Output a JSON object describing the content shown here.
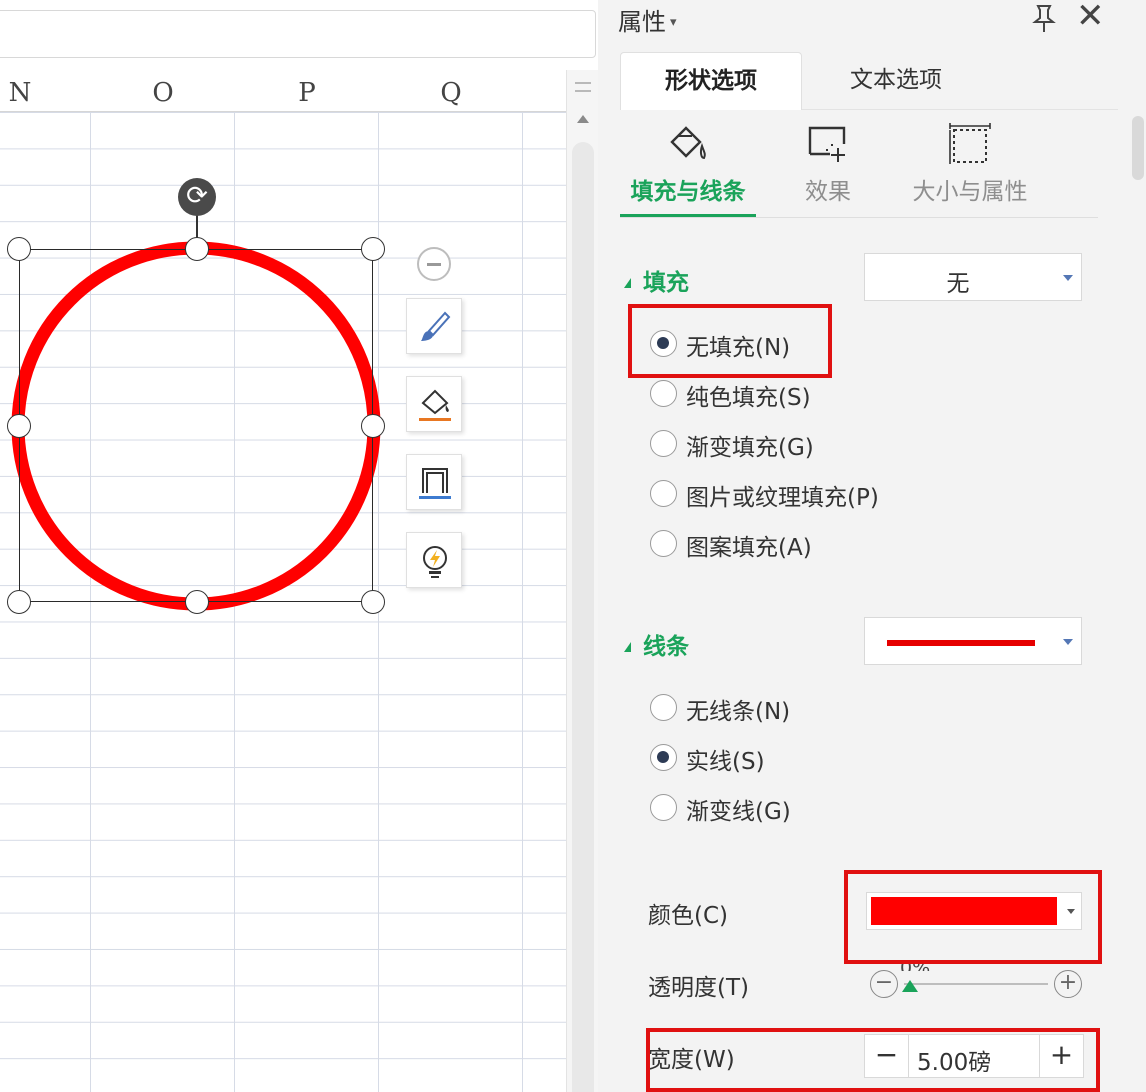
{
  "sheet": {
    "columns": [
      "N",
      "O",
      "P",
      "Q"
    ],
    "rotate_glyph": "⟳",
    "float_tools": [
      "collapse-icon",
      "brush-icon",
      "fill-bucket-icon",
      "outline-icon",
      "bulb-icon"
    ]
  },
  "panel": {
    "title": "属性",
    "title_caret": "▾",
    "close_glyph": "✕",
    "tabs": [
      {
        "label": "形状选项",
        "active": true
      },
      {
        "label": "文本选项",
        "active": false
      }
    ],
    "subtabs": [
      {
        "label": "填充与线条",
        "icon": "fill-line-icon",
        "active": true
      },
      {
        "label": "效果",
        "icon": "effects-icon",
        "active": false
      },
      {
        "label": "大小与属性",
        "icon": "size-properties-icon",
        "active": false
      }
    ],
    "fill": {
      "heading": "填充",
      "dropdown_value": "无",
      "options": [
        {
          "label": "无填充(N)",
          "checked": true
        },
        {
          "label": "纯色填充(S)",
          "checked": false
        },
        {
          "label": "渐变填充(G)",
          "checked": false
        },
        {
          "label": "图片或纹理填充(P)",
          "checked": false
        },
        {
          "label": "图案填充(A)",
          "checked": false
        }
      ]
    },
    "line": {
      "heading": "线条",
      "line_color": "#e60000",
      "options": [
        {
          "label": "无线条(N)",
          "checked": false
        },
        {
          "label": "实线(S)",
          "checked": true
        },
        {
          "label": "渐变线(G)",
          "checked": false
        }
      ],
      "color_label": "颜色(C)",
      "color_value": "#ff0000",
      "transparency_label": "透明度(T)",
      "transparency_value": "0%",
      "transparency_minus": "−",
      "transparency_plus": "+",
      "width_label": "宽度(W)",
      "width_value": "5.00磅",
      "width_minus": "−",
      "width_plus": "+"
    }
  },
  "colors": {
    "accent_green": "#1aa35a",
    "annotation_red": "#e01010",
    "shape_outline": "#ff0000"
  }
}
